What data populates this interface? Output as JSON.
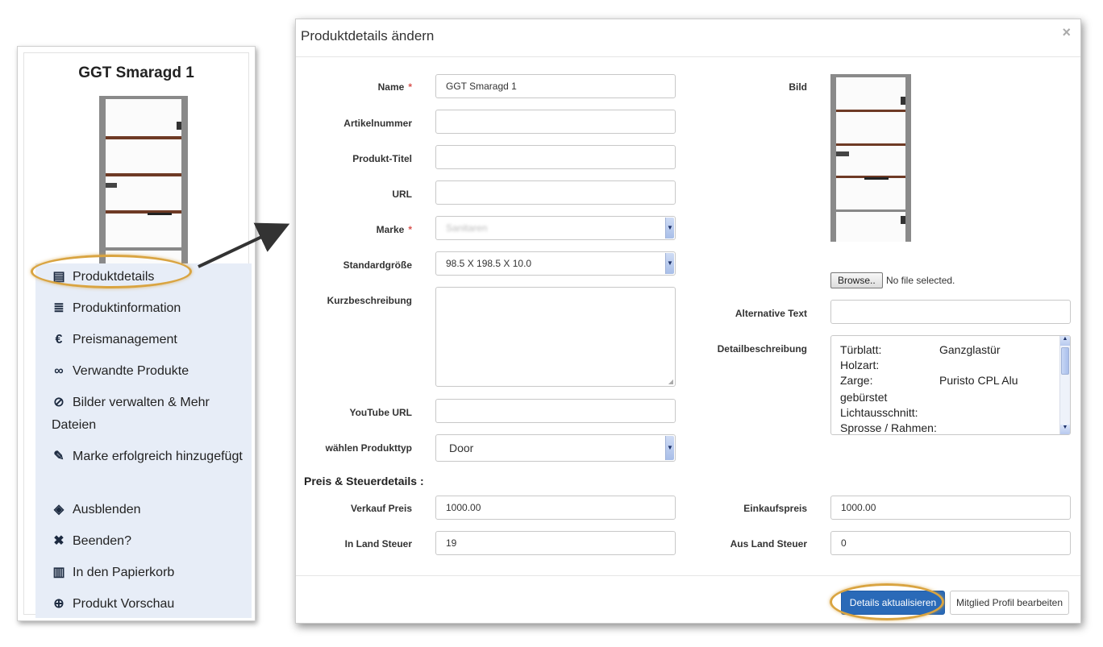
{
  "product_card": {
    "title": "GGT Smaragd 1",
    "menu": [
      {
        "label": "Produktdetails",
        "icon": "list-icon"
      },
      {
        "label": "Produktinformation",
        "icon": "bars-icon"
      },
      {
        "label": "Preismanagement",
        "icon": "euro-icon"
      },
      {
        "label": "Verwandte Produkte",
        "icon": "link-icon"
      },
      {
        "label": "Bilder verwalten & Mehr Dateien",
        "icon": "paperclip-icon"
      },
      {
        "label": "Marke erfolgreich hinzugefügt",
        "icon": "edit-icon"
      },
      {
        "label": "Ausblenden",
        "icon": "eye-slash-icon"
      },
      {
        "label": "Beenden?",
        "icon": "close-icon"
      },
      {
        "label": "In den Papierkorb",
        "icon": "trash-icon"
      },
      {
        "label": "Produkt Vorschau",
        "icon": "zoom-icon"
      }
    ]
  },
  "modal": {
    "title": "Produktdetails ändern",
    "close": "×",
    "fields": {
      "name": {
        "label": "Name",
        "required": "*",
        "value": "GGT Smaragd 1"
      },
      "artikelnummer": {
        "label": "Artikelnummer",
        "value": ""
      },
      "produkt_titel": {
        "label": "Produkt-Titel",
        "value": ""
      },
      "url": {
        "label": "URL",
        "value": ""
      },
      "marke": {
        "label": "Marke",
        "required": "*",
        "value": "Sanitaren"
      },
      "standardgroesse": {
        "label": "Standardgröße",
        "value": "98.5 X 198.5 X 10.0"
      },
      "kurzbeschreibung": {
        "label": "Kurzbeschreibung",
        "value": ""
      },
      "youtube_url": {
        "label": "YouTube URL",
        "value": ""
      },
      "produkttyp": {
        "label": "wählen Produkttyp",
        "value": "Door"
      },
      "bild": {
        "label": "Bild",
        "browse_label": "Browse..",
        "file_status": "No file selected."
      },
      "alternative_text": {
        "label": "Alternative Text",
        "value": ""
      },
      "detailbeschreibung": {
        "label": "Detailbeschreibung",
        "rows": [
          {
            "key": "Türblatt:",
            "value": "Ganzglastür"
          },
          {
            "key": "Holzart:",
            "value": ""
          },
          {
            "key": "Zarge:",
            "value": "Puristo CPL Alu"
          },
          {
            "key": "gebürstet",
            "value": ""
          },
          {
            "key": "Lichtausschnitt:",
            "value": ""
          },
          {
            "key": "Sprosse / Rahmen:",
            "value": ""
          }
        ]
      }
    },
    "price_section": {
      "title": "Preis & Steuerdetails :",
      "verkauf_preis": {
        "label": "Verkauf Preis",
        "value": "1000.00"
      },
      "einkaufspreis": {
        "label": "Einkaufspreis",
        "value": "1000.00"
      },
      "in_land_steuer": {
        "label": "In Land Steuer",
        "value": "19"
      },
      "aus_land_steuer": {
        "label": "Aus Land Steuer",
        "value": "0"
      }
    },
    "footer": {
      "update_label": "Details aktualisieren",
      "profile_label": "Mitglied Profil bearbeiten"
    }
  },
  "colors": {
    "accent": "#2a6ab8",
    "highlight": "#d9a441",
    "menu_bg": "#e7edf7"
  }
}
